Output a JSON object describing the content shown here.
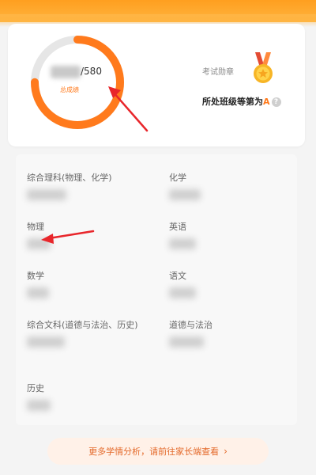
{
  "score": {
    "total_suffix": "/580",
    "caption": "总成绩",
    "ring_fraction": 0.75
  },
  "medal": {
    "label": "考试勋章"
  },
  "grade": {
    "prefix": "所处班级等第为",
    "letter": "A",
    "help_glyph": "?"
  },
  "subjects": [
    {
      "name": "综合理科(物理、化学)"
    },
    {
      "name": "化学"
    },
    {
      "name": "物理"
    },
    {
      "name": "英语"
    },
    {
      "name": "数学"
    },
    {
      "name": "语文"
    },
    {
      "name": "综合文科(道德与法治、历史)"
    },
    {
      "name": "道德与法治"
    },
    {
      "name": "历史"
    }
  ],
  "more_analysis": {
    "label": "更多学情分析，请前往家长端查看",
    "chevron": "›"
  },
  "colors": {
    "accent": "#ff7a1c",
    "header": "#ffa32a",
    "arrow": "#e8262b",
    "ring_track": "#e6e6e6"
  },
  "icons": {
    "medal": "medal-icon",
    "help": "question-circle-icon",
    "chevron": "chevron-right-icon"
  }
}
